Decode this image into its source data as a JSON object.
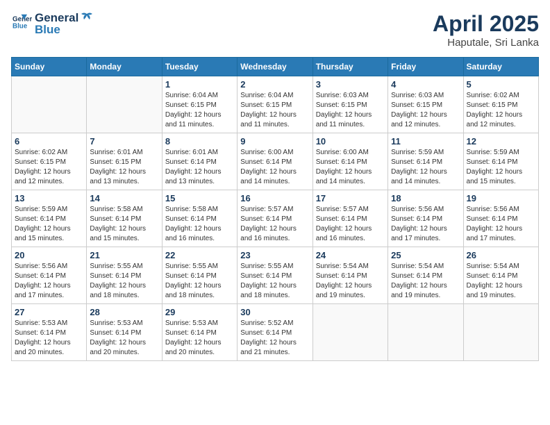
{
  "logo": {
    "line1": "General",
    "line2": "Blue"
  },
  "title": "April 2025",
  "subtitle": "Haputale, Sri Lanka",
  "headers": [
    "Sunday",
    "Monday",
    "Tuesday",
    "Wednesday",
    "Thursday",
    "Friday",
    "Saturday"
  ],
  "weeks": [
    [
      {
        "day": "",
        "info": ""
      },
      {
        "day": "",
        "info": ""
      },
      {
        "day": "1",
        "info": "Sunrise: 6:04 AM\nSunset: 6:15 PM\nDaylight: 12 hours and 11 minutes."
      },
      {
        "day": "2",
        "info": "Sunrise: 6:04 AM\nSunset: 6:15 PM\nDaylight: 12 hours and 11 minutes."
      },
      {
        "day": "3",
        "info": "Sunrise: 6:03 AM\nSunset: 6:15 PM\nDaylight: 12 hours and 11 minutes."
      },
      {
        "day": "4",
        "info": "Sunrise: 6:03 AM\nSunset: 6:15 PM\nDaylight: 12 hours and 12 minutes."
      },
      {
        "day": "5",
        "info": "Sunrise: 6:02 AM\nSunset: 6:15 PM\nDaylight: 12 hours and 12 minutes."
      }
    ],
    [
      {
        "day": "6",
        "info": "Sunrise: 6:02 AM\nSunset: 6:15 PM\nDaylight: 12 hours and 12 minutes."
      },
      {
        "day": "7",
        "info": "Sunrise: 6:01 AM\nSunset: 6:15 PM\nDaylight: 12 hours and 13 minutes."
      },
      {
        "day": "8",
        "info": "Sunrise: 6:01 AM\nSunset: 6:14 PM\nDaylight: 12 hours and 13 minutes."
      },
      {
        "day": "9",
        "info": "Sunrise: 6:00 AM\nSunset: 6:14 PM\nDaylight: 12 hours and 14 minutes."
      },
      {
        "day": "10",
        "info": "Sunrise: 6:00 AM\nSunset: 6:14 PM\nDaylight: 12 hours and 14 minutes."
      },
      {
        "day": "11",
        "info": "Sunrise: 5:59 AM\nSunset: 6:14 PM\nDaylight: 12 hours and 14 minutes."
      },
      {
        "day": "12",
        "info": "Sunrise: 5:59 AM\nSunset: 6:14 PM\nDaylight: 12 hours and 15 minutes."
      }
    ],
    [
      {
        "day": "13",
        "info": "Sunrise: 5:59 AM\nSunset: 6:14 PM\nDaylight: 12 hours and 15 minutes."
      },
      {
        "day": "14",
        "info": "Sunrise: 5:58 AM\nSunset: 6:14 PM\nDaylight: 12 hours and 15 minutes."
      },
      {
        "day": "15",
        "info": "Sunrise: 5:58 AM\nSunset: 6:14 PM\nDaylight: 12 hours and 16 minutes."
      },
      {
        "day": "16",
        "info": "Sunrise: 5:57 AM\nSunset: 6:14 PM\nDaylight: 12 hours and 16 minutes."
      },
      {
        "day": "17",
        "info": "Sunrise: 5:57 AM\nSunset: 6:14 PM\nDaylight: 12 hours and 16 minutes."
      },
      {
        "day": "18",
        "info": "Sunrise: 5:56 AM\nSunset: 6:14 PM\nDaylight: 12 hours and 17 minutes."
      },
      {
        "day": "19",
        "info": "Sunrise: 5:56 AM\nSunset: 6:14 PM\nDaylight: 12 hours and 17 minutes."
      }
    ],
    [
      {
        "day": "20",
        "info": "Sunrise: 5:56 AM\nSunset: 6:14 PM\nDaylight: 12 hours and 17 minutes."
      },
      {
        "day": "21",
        "info": "Sunrise: 5:55 AM\nSunset: 6:14 PM\nDaylight: 12 hours and 18 minutes."
      },
      {
        "day": "22",
        "info": "Sunrise: 5:55 AM\nSunset: 6:14 PM\nDaylight: 12 hours and 18 minutes."
      },
      {
        "day": "23",
        "info": "Sunrise: 5:55 AM\nSunset: 6:14 PM\nDaylight: 12 hours and 18 minutes."
      },
      {
        "day": "24",
        "info": "Sunrise: 5:54 AM\nSunset: 6:14 PM\nDaylight: 12 hours and 19 minutes."
      },
      {
        "day": "25",
        "info": "Sunrise: 5:54 AM\nSunset: 6:14 PM\nDaylight: 12 hours and 19 minutes."
      },
      {
        "day": "26",
        "info": "Sunrise: 5:54 AM\nSunset: 6:14 PM\nDaylight: 12 hours and 19 minutes."
      }
    ],
    [
      {
        "day": "27",
        "info": "Sunrise: 5:53 AM\nSunset: 6:14 PM\nDaylight: 12 hours and 20 minutes."
      },
      {
        "day": "28",
        "info": "Sunrise: 5:53 AM\nSunset: 6:14 PM\nDaylight: 12 hours and 20 minutes."
      },
      {
        "day": "29",
        "info": "Sunrise: 5:53 AM\nSunset: 6:14 PM\nDaylight: 12 hours and 20 minutes."
      },
      {
        "day": "30",
        "info": "Sunrise: 5:52 AM\nSunset: 6:14 PM\nDaylight: 12 hours and 21 minutes."
      },
      {
        "day": "",
        "info": ""
      },
      {
        "day": "",
        "info": ""
      },
      {
        "day": "",
        "info": ""
      }
    ]
  ]
}
